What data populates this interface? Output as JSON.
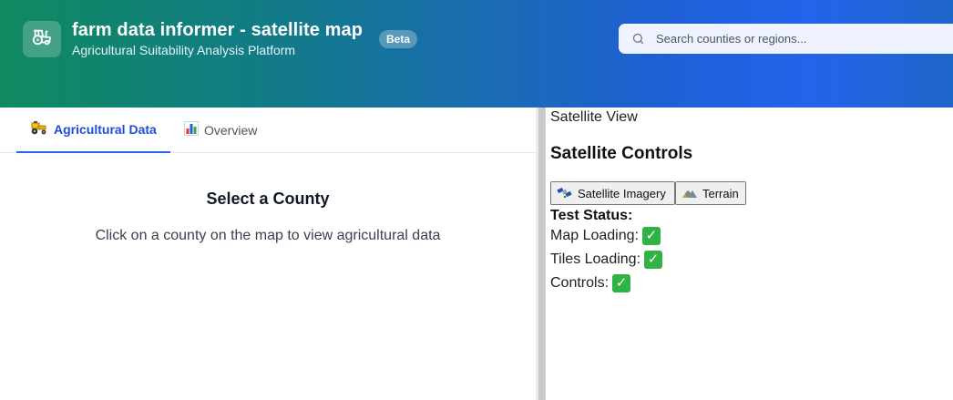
{
  "header": {
    "title": "farm data informer - satellite map",
    "badge": "Beta",
    "subtitle": "Agricultural Suitability Analysis Platform",
    "logo_icon": "tractor-icon",
    "search": {
      "placeholder": "Search counties or regions...",
      "value": "",
      "icon": "search-icon"
    },
    "colors": {
      "gradient_start": "#0f8a5f",
      "gradient_end": "#2563eb"
    }
  },
  "tabs": [
    {
      "label": "Agricultural Data",
      "icon": "tractor-icon",
      "active": true
    },
    {
      "label": "Overview",
      "icon": "bar-chart-icon",
      "active": false
    }
  ],
  "left_panel": {
    "title": "Select a County",
    "description": "Click on a county on the map to view agricultural data"
  },
  "right_panel": {
    "view_label": "Satellite View",
    "controls_title": "Satellite Controls",
    "buttons": [
      {
        "label": "Satellite Imagery",
        "icon": "satellite-icon"
      },
      {
        "label": "Terrain",
        "icon": "mountain-icon"
      }
    ],
    "test_status": {
      "title": "Test Status:",
      "items": [
        {
          "label": "Map Loading:",
          "status": "check-icon"
        },
        {
          "label": "Tiles Loading:",
          "status": "check-icon"
        },
        {
          "label": "Controls:",
          "status": "check-icon"
        }
      ]
    }
  }
}
